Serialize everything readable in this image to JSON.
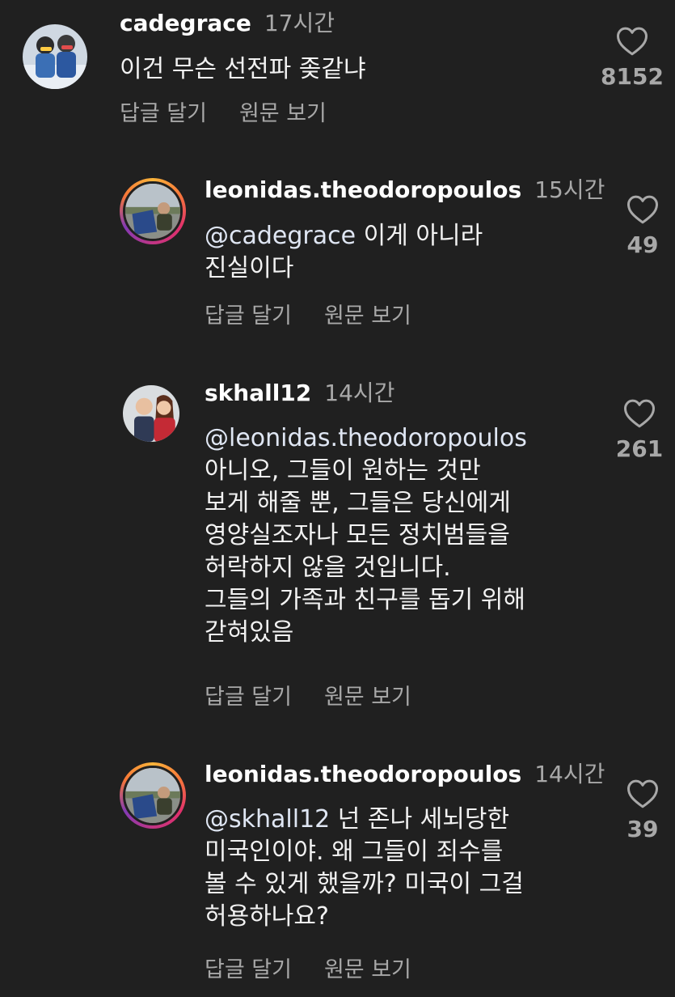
{
  "comments": [
    {
      "username": "cadegrace",
      "time": "17시간",
      "mention": "",
      "text": "이건 무슨 선전파 좆같냐",
      "reply_label": "답글 달기",
      "view_original_label": "원문 보기",
      "likes": "8152",
      "avatar_icon": "avatar-photo"
    },
    {
      "username": "leonidas.theodoropoulos",
      "time": "15시간",
      "mention": "@cadegrace",
      "text": " 이게 아니라\n진실이다",
      "reply_label": "답글 달기",
      "view_original_label": "원문 보기",
      "likes": "49",
      "avatar_icon": "avatar-photo-story-ring"
    },
    {
      "username": "skhall12",
      "time": "14시간",
      "mention": "@leonidas.theodoropoulos",
      "text": "아니오, 그들이 원하는 것만\n보게 해줄 뿐, 그들은 당신에게\n영양실조자나 모든 정치범들을\n허락하지 않을 것입니다.\n그들의 가족과 친구를 돕기 위해\n갇혀있음",
      "reply_label": "답글 달기",
      "view_original_label": "원문 보기",
      "likes": "261",
      "avatar_icon": "avatar-photo"
    },
    {
      "username": "leonidas.theodoropoulos",
      "time": "14시간",
      "mention": "@skhall12",
      "text": " 넌 존나 세뇌당한\n미국인이야. 왜 그들이 죄수를\n볼 수 있게 했을까? 미국이 그걸\n허용하나요?",
      "reply_label": "답글 달기",
      "view_original_label": "원문 보기",
      "likes": "39",
      "avatar_icon": "avatar-photo-story-ring"
    }
  ],
  "colors": {
    "background": "#202020",
    "username": "#ffffff",
    "secondary": "#a8a8a8",
    "story_ring": "#e1306c"
  },
  "icons": {
    "like": "heart-outline-icon"
  }
}
